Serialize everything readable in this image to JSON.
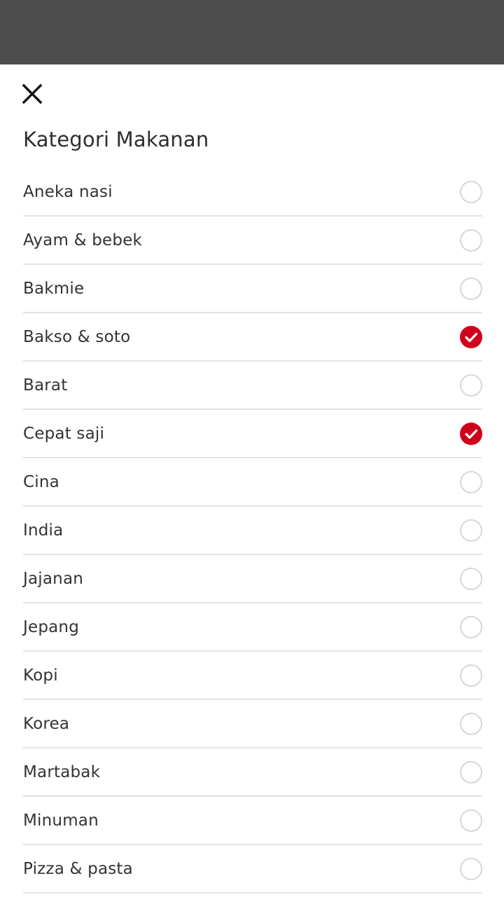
{
  "header": {
    "close_icon": "close-icon",
    "title": "Kategori Makanan"
  },
  "colors": {
    "accent": "#d0021b",
    "overlay": "#4d4d4d",
    "divider": "#e3e3e3"
  },
  "categories": [
    {
      "label": "Aneka nasi",
      "checked": false
    },
    {
      "label": "Ayam & bebek",
      "checked": false
    },
    {
      "label": "Bakmie",
      "checked": false
    },
    {
      "label": "Bakso & soto",
      "checked": true
    },
    {
      "label": "Barat",
      "checked": false
    },
    {
      "label": "Cepat saji",
      "checked": true
    },
    {
      "label": "Cina",
      "checked": false
    },
    {
      "label": "India",
      "checked": false
    },
    {
      "label": "Jajanan",
      "checked": false
    },
    {
      "label": "Jepang",
      "checked": false
    },
    {
      "label": "Kopi",
      "checked": false
    },
    {
      "label": "Korea",
      "checked": false
    },
    {
      "label": "Martabak",
      "checked": false
    },
    {
      "label": "Minuman",
      "checked": false
    },
    {
      "label": "Pizza & pasta",
      "checked": false
    }
  ]
}
